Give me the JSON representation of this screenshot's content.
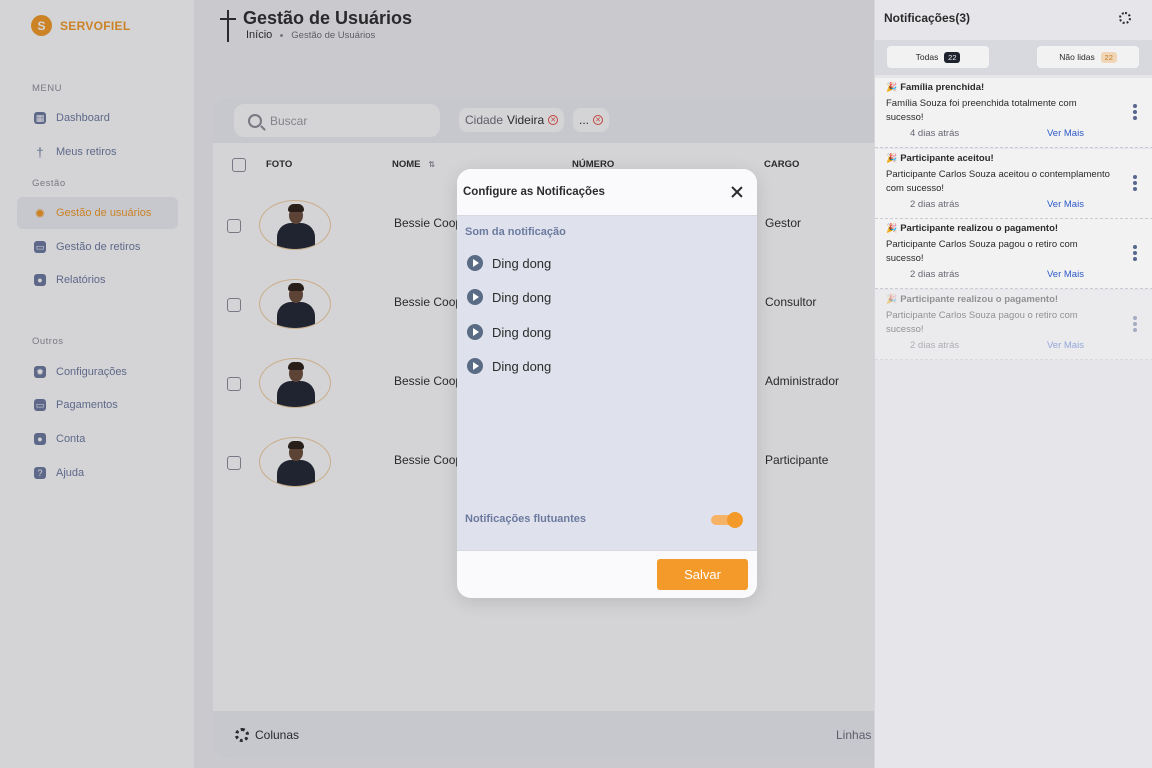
{
  "brand": {
    "initial": "S",
    "name": "SERVOFIEL"
  },
  "sidebar": {
    "section_menu": "MENU",
    "section_gestao": "Gestão",
    "section_outros": "Outros",
    "items": [
      {
        "label": "Dashboard",
        "icon": "dashboard-icon"
      },
      {
        "label": "Meus retiros",
        "icon": "cross-icon"
      },
      {
        "label": "Gestão de usuários",
        "icon": "gear-icon",
        "active": true
      },
      {
        "label": "Gestão de retiros",
        "icon": "wallet-icon"
      },
      {
        "label": "Relatórios",
        "icon": "user-icon"
      },
      {
        "label": "Configurações",
        "icon": "gear-icon"
      },
      {
        "label": "Pagamentos",
        "icon": "wallet-icon"
      },
      {
        "label": "Conta",
        "icon": "user-icon"
      },
      {
        "label": "Ajuda",
        "icon": "help-icon"
      }
    ]
  },
  "header": {
    "title": "Gestão de Usuários",
    "breadcrumb_home": "Início",
    "breadcrumb_current": "Gestão de Usuários"
  },
  "filters": {
    "search_placeholder": "Buscar",
    "chip_city_label": "Cidade",
    "chip_city_value": "Videira",
    "chip_more": "..."
  },
  "table": {
    "columns": {
      "foto": "FOTO",
      "nome": "NOME",
      "numero": "NÚMERO",
      "cargo": "CARGO"
    },
    "rows": [
      {
        "name": "Bessie Coop",
        "role": "Gestor"
      },
      {
        "name": "Bessie Coop",
        "role": "Consultor"
      },
      {
        "name": "Bessie Coop",
        "role": "Administrador"
      },
      {
        "name": "Bessie Coop",
        "role": "Participante"
      }
    ],
    "footer_columns": "Colunas",
    "footer_rows": "Linhas"
  },
  "notifications": {
    "title": "Notificações(3)",
    "tab_all": "Todas",
    "tab_all_count": "22",
    "tab_unread": "Não lidas",
    "tab_unread_count": "22",
    "items": [
      {
        "title": "Família prenchida!",
        "body": "Família Souza foi preenchida totalmente com sucesso!",
        "when": "4 dias atrás",
        "more": "Ver Mais"
      },
      {
        "title": "Participante aceitou!",
        "body": "Participante Carlos Souza aceitou o contemplamento com  sucesso!",
        "when": "2 dias atrás",
        "more": "Ver Mais"
      },
      {
        "title": "Participante realizou o pagamento!",
        "body": "Participante Carlos Souza pagou o retiro com sucesso!",
        "when": "2 dias atrás",
        "more": "Ver Mais"
      },
      {
        "title": "Participante realizou o pagamento!",
        "body": "Participante Carlos Souza pagou o retiro com sucesso!",
        "when": "2 dias atrás",
        "more": "Ver Mais"
      }
    ]
  },
  "modal": {
    "title": "Configure as Notificações",
    "section_sound": "Som da notificação",
    "sounds": [
      "Ding dong",
      "Ding dong",
      "Ding dong",
      "Ding dong"
    ],
    "floating_label": "Notificações flutuantes",
    "floating_enabled": true,
    "save_label": "Salvar"
  },
  "colors": {
    "accent": "#f39a2a",
    "link": "#2f5fd0",
    "muted": "#6c7aa0"
  }
}
